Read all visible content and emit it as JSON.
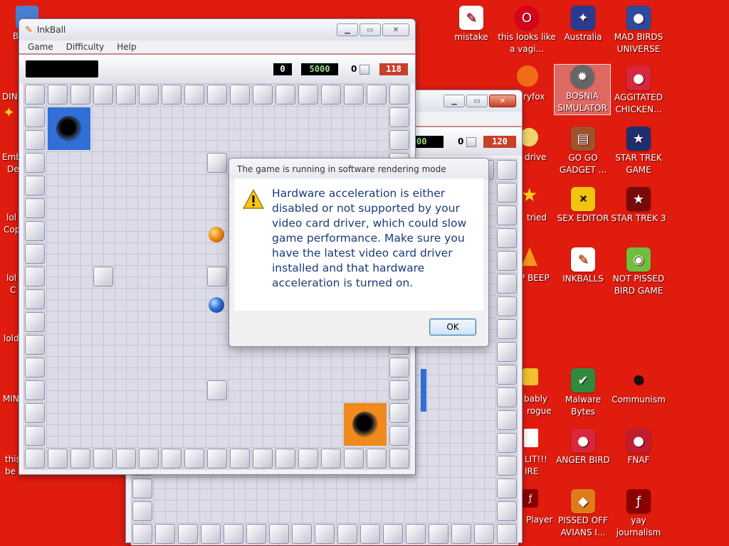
{
  "desktop": {
    "icons": [
      {
        "label": "mistake",
        "icon": "notebook-icon",
        "color": "#c8102e"
      },
      {
        "label": "this looks like a vagi...",
        "icon": "opera-icon",
        "color": "#d9001b"
      },
      {
        "label": "Australia",
        "icon": "australia-icon",
        "color": "#2a3b8f"
      },
      {
        "label": "MAD BIRDS UNIVERSE",
        "icon": "angry-birds-space-icon",
        "color": "#2b4aa0"
      },
      {
        "label": "BOSNIA SIMULATOR",
        "icon": "cog-icon",
        "color": "#555555"
      },
      {
        "label": "AGGITATED CHICKEN...",
        "icon": "angry-bird-icon",
        "color": "#d7263d"
      },
      {
        "label": "GO GO GADGET ...",
        "icon": "briefcase-icon",
        "color": "#a0522d"
      },
      {
        "label": "STAR TREK GAME",
        "icon": "star-wars-icon",
        "color": "#1d2f6f"
      },
      {
        "label": "SEX EDITOR",
        "icon": "hd-icon",
        "color": "#f1c40f"
      },
      {
        "label": "STAR TREK 3",
        "icon": "star-wars-icon",
        "color": "#7a0a0a"
      },
      {
        "label": "INKBALLS",
        "icon": "inkball-icon",
        "color": "#2f6fd6"
      },
      {
        "label": "NOT PISSED BIRD GAME",
        "icon": "green-pig-icon",
        "color": "#6fbf3f"
      },
      {
        "label": "Malware Bytes",
        "icon": "shield-icon",
        "color": "#2e8b3e"
      },
      {
        "label": "Communism",
        "icon": "ladybug-icon",
        "color": "#111111"
      },
      {
        "label": "ANGER BIRD",
        "icon": "angry-bird-icon",
        "color": "#d7263d"
      },
      {
        "label": "FNAF",
        "icon": "angry-bird-icon",
        "color": "#c01e2e"
      },
      {
        "label": "PISSED OFF AVIANS I...",
        "icon": "angry-birds-rio-icon",
        "color": "#e07b1a"
      },
      {
        "label": "yay journalism",
        "icon": "flash-icon",
        "color": "#8b0000"
      }
    ],
    "partial_labels": [
      {
        "text": "ryfox"
      },
      {
        "text": "drive"
      },
      {
        "text": "tried"
      },
      {
        "text": "P BEEP"
      },
      {
        "text": "bably"
      },
      {
        "text": "rogue"
      },
      {
        "text": "LIT!!!"
      },
      {
        "text": "IRE"
      },
      {
        "text": "Player"
      },
      {
        "text": "B"
      },
      {
        "text": "DIN"
      },
      {
        "text": "Emb"
      },
      {
        "text": "De"
      },
      {
        "text": "lol"
      },
      {
        "text": "Cop"
      },
      {
        "text": "lol"
      },
      {
        "text": "C"
      },
      {
        "text": "lold"
      },
      {
        "text": "MIN"
      },
      {
        "text": "this"
      },
      {
        "text": "be"
      }
    ]
  },
  "inkball_front": {
    "title": "InkBall",
    "menu": [
      "Game",
      "Difficulty",
      "Help"
    ],
    "score": "0",
    "time": "5000",
    "balls": "0",
    "remaining": "118"
  },
  "inkball_back": {
    "time": "5000",
    "balls": "0",
    "remaining": "120"
  },
  "dialog": {
    "title": "The game is running in software rendering mode",
    "message": "Hardware acceleration is either disabled or not supported by your video card driver, which could slow game performance. Make sure you have the latest video card driver installed and that hardware acceleration is turned on.",
    "ok_label": "OK"
  },
  "colors": {
    "desktop": "#e01c0f",
    "score_text": "#ffffff",
    "time_text": "#9be28a",
    "remaining_bg": "#c8402a",
    "blue_hole": "#2f6fd6",
    "orange_hole": "#f08a1c"
  }
}
